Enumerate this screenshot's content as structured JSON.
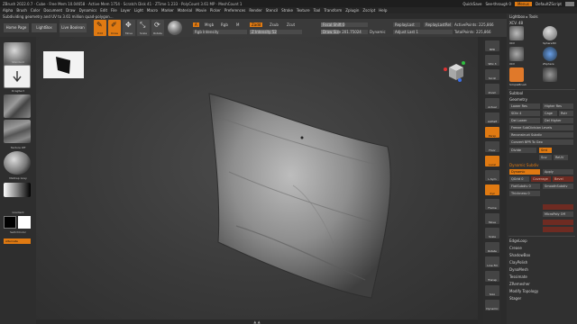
{
  "window": {
    "title": "ZBrush 2022.0.7 · Cube · Free Mem 10.04658 · Active Mem 1754 · Scratch Disk 41 · ZTime 1.233 · PolyCount 3.61 MP · MeshCount 1",
    "quicksave": "QuickSave",
    "seethrough": "See-through  0",
    "menus": "Menus",
    "default_script": "DefaultZScript"
  },
  "menubar": [
    "Alpha",
    "Brush",
    "Color",
    "Document",
    "Draw",
    "Dynamics",
    "Edit",
    "File",
    "Layer",
    "Light",
    "Macro",
    "Marker",
    "Material",
    "Movie",
    "Picker",
    "Preferences",
    "Render",
    "Stencil",
    "Stroke",
    "Texture",
    "Tool",
    "Transform",
    "Zplugin",
    "Zscript",
    "Help"
  ],
  "notice": "Subdividing geometry and UV to 3.61 million quad-polygon…",
  "nav": {
    "home": "Home Page",
    "lightbox": "LightBox",
    "live_boolean": "Live Boolean"
  },
  "tools": [
    {
      "name": "edit",
      "label": "Edit",
      "glyph": "✎",
      "active": true
    },
    {
      "name": "draw",
      "label": "Draw",
      "glyph": "✐",
      "active": true
    },
    {
      "name": "move",
      "label": "Move",
      "glyph": "✥",
      "active": false
    },
    {
      "name": "scale",
      "label": "Scale",
      "glyph": "⤡",
      "active": false
    },
    {
      "name": "rotate",
      "label": "Rotate",
      "glyph": "⟳",
      "active": false
    }
  ],
  "brush_modes": {
    "a": "A",
    "mrgb": "Mrgb",
    "rgb": "Rgb",
    "m": "M",
    "zadd": "Zadd",
    "zsub": "Zsub",
    "zcut": "Zcut"
  },
  "sliders": {
    "rgb_intensity": "Rgb Intensity",
    "z_intensity": "Z Intensity 52",
    "focal_shift": "Focal Shift 0",
    "draw_size": "Draw Size 201.75024",
    "dynamic": "Dynamic",
    "replay_last": "ReplayLast",
    "replay_last_rel": "ReplayLastRel",
    "adjust_last": "Adjust Last 1",
    "active_points": "ActivePoints: 225,866",
    "total_points": "TotalPoints: 225,866"
  },
  "left_panel": {
    "standard_label": "Standard",
    "dragrect_label": "DragRect",
    "texture_label": "Texture Off",
    "material_label": "MatCap Gray",
    "gradient_label": "Gradient",
    "switch_color_label": "SwitchColor",
    "alternate_label": "Alternate"
  },
  "right_strip": [
    {
      "label": "BPR",
      "active": false
    },
    {
      "label": "SPix 3",
      "active": false
    },
    {
      "label": "Scroll",
      "active": false
    },
    {
      "label": "Zoom",
      "active": false
    },
    {
      "label": "Actual",
      "active": false
    },
    {
      "label": "AAHalf",
      "active": false
    },
    {
      "label": "Persp",
      "active": true
    },
    {
      "label": "Floor",
      "active": false
    },
    {
      "label": "Local",
      "active": true
    },
    {
      "label": "L.Sym",
      "active": false
    },
    {
      "label": "Xyz",
      "active": true
    },
    {
      "label": "Frame",
      "active": false
    },
    {
      "label": "Move",
      "active": false
    },
    {
      "label": "Scale",
      "active": false
    },
    {
      "label": "Rotate",
      "active": false
    },
    {
      "label": "Line Fill",
      "active": false
    },
    {
      "label": "Transp",
      "active": false
    },
    {
      "label": "Solo",
      "active": false
    },
    {
      "label": "Dynamic",
      "active": false
    }
  ],
  "tray": {
    "tool_header": "Lightbox ▸ Tools",
    "tool_value": "XCV. 48",
    "thumbs": [
      "XCV",
      "Sphere3D",
      "XCV",
      "ZSphere",
      "SimpleBrush",
      "Cylinder3D"
    ],
    "subtool": "Subtool",
    "geometry": "Geometry",
    "lower_res": "Lower Res",
    "higher_res": "Higher Res",
    "sdiv": "SDiv 4",
    "cage": "Cage",
    "rstr": "Rstr",
    "del_lower": "Del Lower",
    "del_higher": "Del Higher",
    "freeze": "Freeze SubDivision Levels",
    "reconstruct": "Reconstruct Subdiv",
    "convert": "Convert BPR To Geo",
    "divide": "Divide",
    "smt": "Smt",
    "suv": "Suv",
    "reuv": "ReUV",
    "dynamic_subdiv": "Dynamic Subdiv",
    "dynamic": "Dynamic",
    "apply": "Apply",
    "qgrid": "QGrid 0",
    "coverage": "Coverage",
    "bevel": "Bevel",
    "flat_subdiv": "FlatSubdiv 0",
    "smooth_subdiv": "SmoothSubdiv",
    "thickness": "Thickness 0",
    "micro_poly": "MicroPoly Off",
    "edge_loop": "EdgeLoop",
    "crease": "Crease",
    "shadow_box": "ShadowBox",
    "clay_polish": "ClayPolish",
    "dyna_mesh": "DynaMesh",
    "tessimate": "Tessimate",
    "zremesher": "ZRemesher",
    "modify_topology": "Modify Topology",
    "stager": "Stager"
  },
  "colors": {
    "accent": "#e07a12",
    "bg": "#2b2b2b",
    "panel": "#303030"
  }
}
